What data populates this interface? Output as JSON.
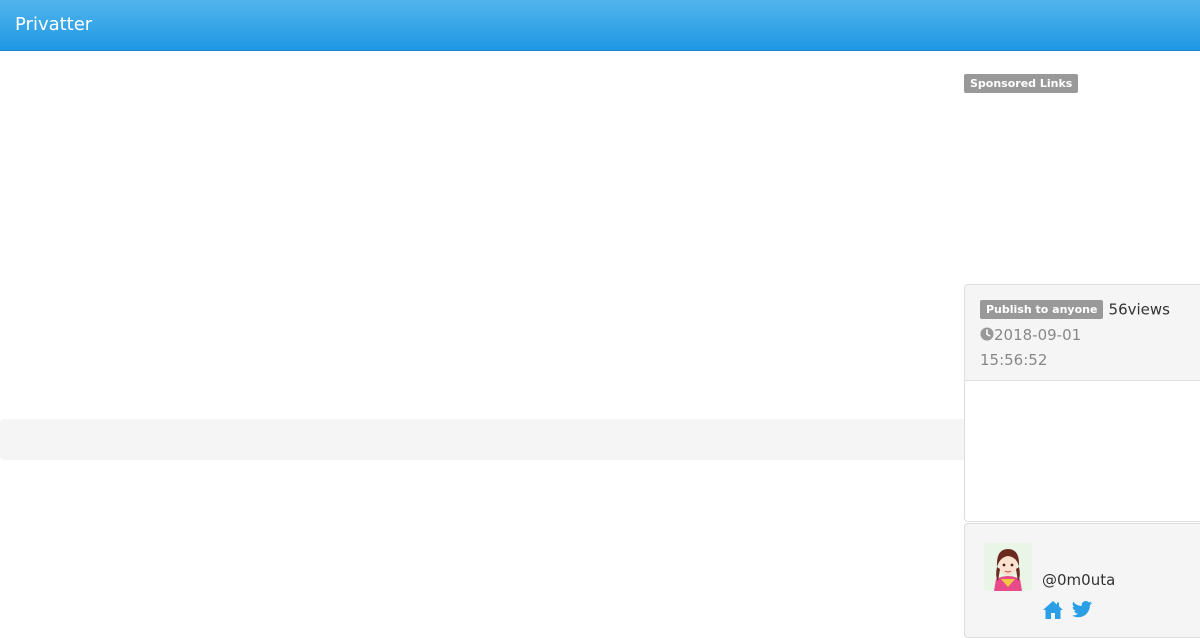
{
  "navbar": {
    "brand": "Privatter",
    "background_color": "#2a9fe6"
  },
  "sidebar": {
    "sponsored_label": "Sponsored Links",
    "post_info": {
      "visibility_badge": "Publish to anyone",
      "views_count": "56",
      "views_unit": "views",
      "date": "2018-09-01",
      "time": "15:56:52"
    },
    "user": {
      "handle": "@0m0uta",
      "links": [
        {
          "icon": "home-icon"
        },
        {
          "icon": "twitter-icon"
        }
      ]
    }
  },
  "colors": {
    "accent": "#2a9fe6",
    "badge": "#999999",
    "icon": "#2a9fe6"
  }
}
